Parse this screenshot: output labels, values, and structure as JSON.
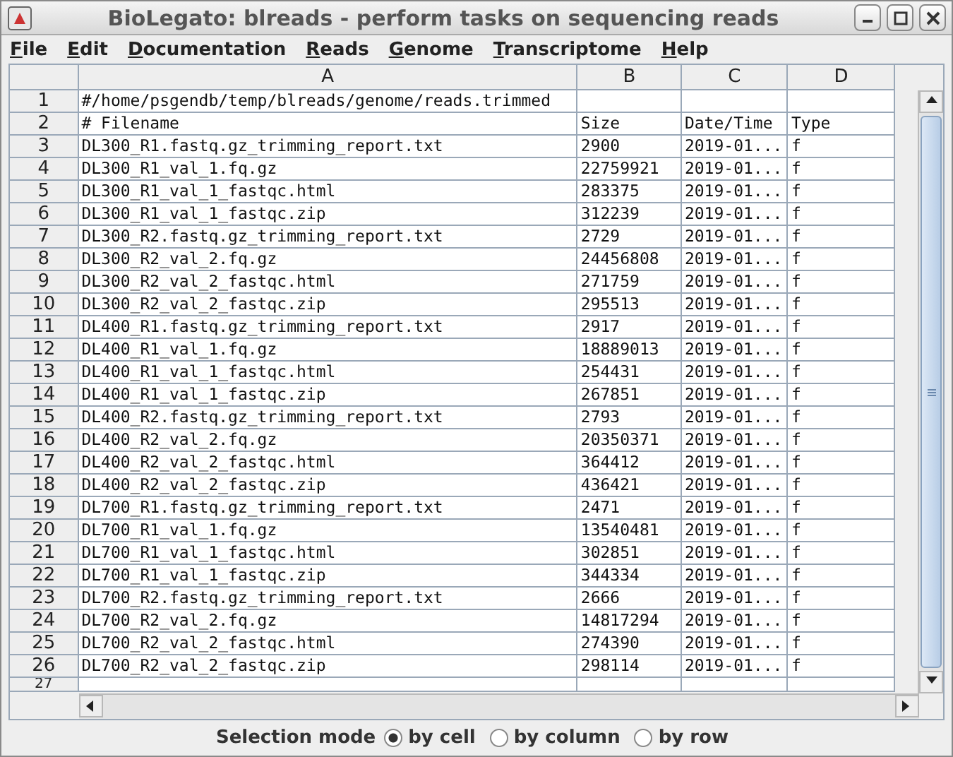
{
  "window": {
    "title": "BioLegato: blreads - perform tasks on sequencing reads"
  },
  "menu": [
    {
      "label": "File"
    },
    {
      "label": "Edit"
    },
    {
      "label": "Documentation"
    },
    {
      "label": "Reads"
    },
    {
      "label": "Genome"
    },
    {
      "label": "Transcriptome"
    },
    {
      "label": "Help"
    }
  ],
  "table": {
    "columns": [
      "A",
      "B",
      "C",
      "D"
    ],
    "rows": [
      {
        "number": "1",
        "cells": [
          "#/home/psgendb/temp/blreads/genome/reads.trimmed",
          "",
          "",
          ""
        ]
      },
      {
        "number": "2",
        "cells": [
          "# Filename",
          "Size",
          "Date/Time",
          "Type"
        ]
      },
      {
        "number": "3",
        "cells": [
          "DL300_R1.fastq.gz_trimming_report.txt",
          "2900",
          "2019-01...",
          "f"
        ]
      },
      {
        "number": "4",
        "cells": [
          "DL300_R1_val_1.fq.gz",
          "22759921",
          "2019-01...",
          "f"
        ]
      },
      {
        "number": "5",
        "cells": [
          "DL300_R1_val_1_fastqc.html",
          "283375",
          "2019-01...",
          "f"
        ]
      },
      {
        "number": "6",
        "cells": [
          "DL300_R1_val_1_fastqc.zip",
          "312239",
          "2019-01...",
          "f"
        ]
      },
      {
        "number": "7",
        "cells": [
          "DL300_R2.fastq.gz_trimming_report.txt",
          "2729",
          "2019-01...",
          "f"
        ]
      },
      {
        "number": "8",
        "cells": [
          "DL300_R2_val_2.fq.gz",
          "24456808",
          "2019-01...",
          "f"
        ]
      },
      {
        "number": "9",
        "cells": [
          "DL300_R2_val_2_fastqc.html",
          "271759",
          "2019-01...",
          "f"
        ]
      },
      {
        "number": "10",
        "cells": [
          "DL300_R2_val_2_fastqc.zip",
          "295513",
          "2019-01...",
          "f"
        ]
      },
      {
        "number": "11",
        "cells": [
          "DL400_R1.fastq.gz_trimming_report.txt",
          "2917",
          "2019-01...",
          "f"
        ]
      },
      {
        "number": "12",
        "cells": [
          "DL400_R1_val_1.fq.gz",
          "18889013",
          "2019-01...",
          "f"
        ]
      },
      {
        "number": "13",
        "cells": [
          "DL400_R1_val_1_fastqc.html",
          "254431",
          "2019-01...",
          "f"
        ]
      },
      {
        "number": "14",
        "cells": [
          "DL400_R1_val_1_fastqc.zip",
          "267851",
          "2019-01...",
          "f"
        ]
      },
      {
        "number": "15",
        "cells": [
          "DL400_R2.fastq.gz_trimming_report.txt",
          "2793",
          "2019-01...",
          "f"
        ]
      },
      {
        "number": "16",
        "cells": [
          "DL400_R2_val_2.fq.gz",
          "20350371",
          "2019-01...",
          "f"
        ]
      },
      {
        "number": "17",
        "cells": [
          "DL400_R2_val_2_fastqc.html",
          "364412",
          "2019-01...",
          "f"
        ]
      },
      {
        "number": "18",
        "cells": [
          "DL400_R2_val_2_fastqc.zip",
          "436421",
          "2019-01...",
          "f"
        ]
      },
      {
        "number": "19",
        "cells": [
          "DL700_R1.fastq.gz_trimming_report.txt",
          "2471",
          "2019-01...",
          "f"
        ]
      },
      {
        "number": "20",
        "cells": [
          "DL700_R1_val_1.fq.gz",
          "13540481",
          "2019-01...",
          "f"
        ]
      },
      {
        "number": "21",
        "cells": [
          "DL700_R1_val_1_fastqc.html",
          "302851",
          "2019-01...",
          "f"
        ]
      },
      {
        "number": "22",
        "cells": [
          "DL700_R1_val_1_fastqc.zip",
          "344334",
          "2019-01...",
          "f"
        ]
      },
      {
        "number": "23",
        "cells": [
          "DL700_R2.fastq.gz_trimming_report.txt",
          "2666",
          "2019-01...",
          "f"
        ]
      },
      {
        "number": "24",
        "cells": [
          "DL700_R2_val_2.fq.gz",
          "14817294",
          "2019-01...",
          "f"
        ]
      },
      {
        "number": "25",
        "cells": [
          "DL700_R2_val_2_fastqc.html",
          "274390",
          "2019-01...",
          "f"
        ]
      },
      {
        "number": "26",
        "cells": [
          "DL700_R2_val_2_fastqc.zip",
          "298114",
          "2019-01...",
          "f"
        ]
      },
      {
        "number": "27",
        "cells": [
          "",
          "",
          "",
          ""
        ]
      }
    ]
  },
  "selection_mode": {
    "label": "Selection mode",
    "options": [
      {
        "label": "by cell",
        "selected": true
      },
      {
        "label": "by column",
        "selected": false
      },
      {
        "label": "by row",
        "selected": false
      }
    ]
  }
}
